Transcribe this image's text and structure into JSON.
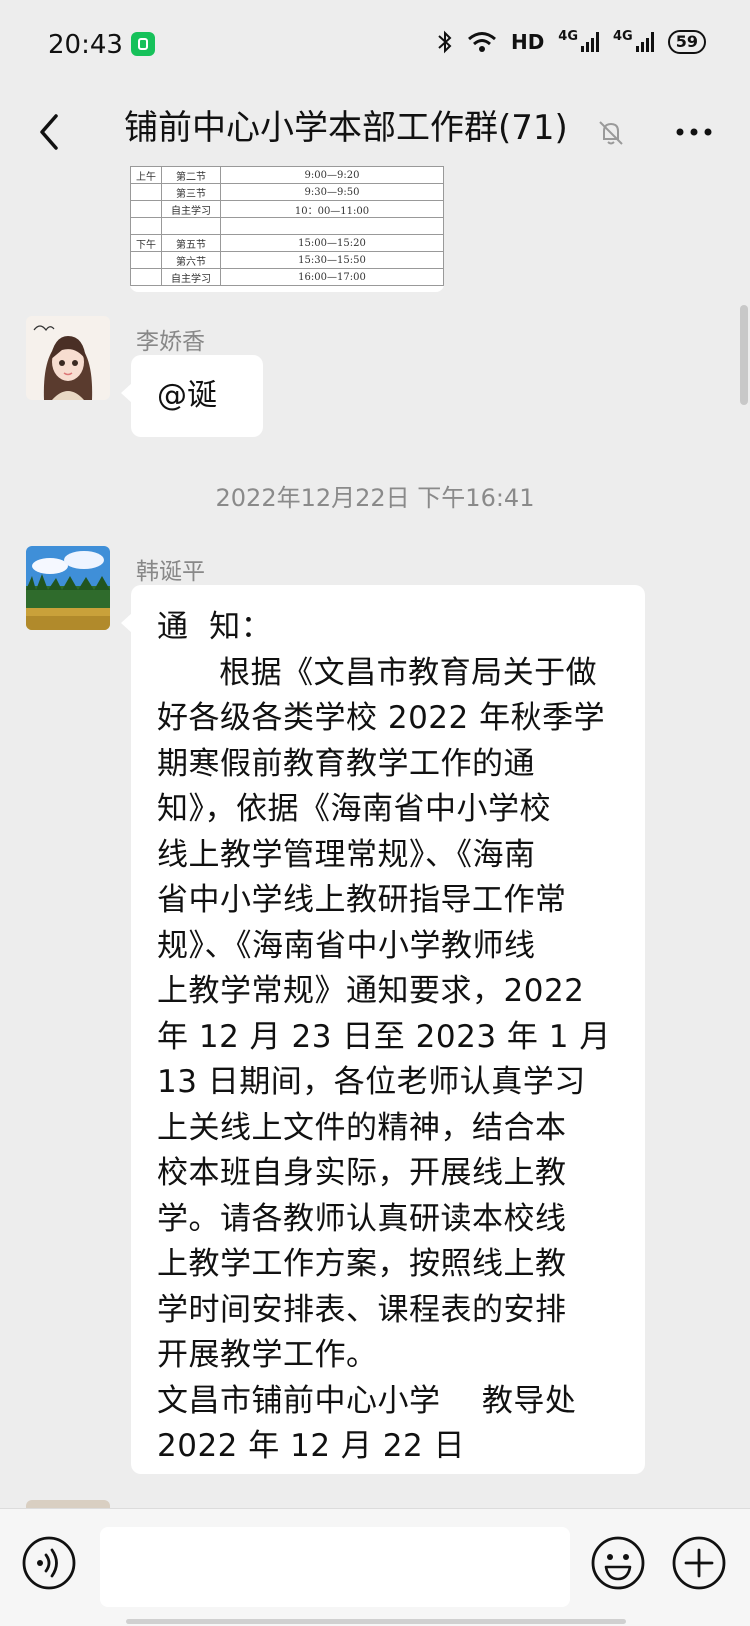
{
  "status_bar": {
    "time": "20:43",
    "network_label": "HD",
    "signal_1": "4G",
    "signal_2": "4G",
    "battery": "59"
  },
  "header": {
    "title": "铺前中心小学本部工作群(71)"
  },
  "shared_image": {
    "rows": [
      {
        "period": "上午",
        "slot": "第二节",
        "time": "9:00—9:20"
      },
      {
        "period": "",
        "slot": "第三节",
        "time": "9:30—9:50"
      },
      {
        "period": "",
        "slot": "自主学习",
        "time": "10：00—11:00"
      },
      {
        "period": "",
        "slot": "",
        "time": ""
      },
      {
        "period": "下午",
        "slot": "第五节",
        "time": "15:00—15:20"
      },
      {
        "period": "",
        "slot": "第六节",
        "time": "15:30—15:50"
      },
      {
        "period": "",
        "slot": "自主学习",
        "time": "16:00—17:00"
      }
    ]
  },
  "messages": [
    {
      "sender": "李娇香",
      "text": "@诞"
    },
    {
      "sender": "韩诞平",
      "lines": [
        "通  知：",
        "      根据《文昌市教育局关于做",
        "好各级各类学校 2022 年秋季学",
        "期寒假前教育教学工作的通",
        "知》，依据《海南省中小学校",
        "线上教学管理常规》、《海南",
        "省中小学线上教研指导工作常",
        "规》、《海南省中小学教师线",
        "上教学常规》通知要求，2022",
        "年 12 月 23 日至 2023 年 1 月",
        "13 日期间，各位老师认真学习",
        "上关线上文件的精神，结合本",
        "校本班自身实际，开展线上教",
        "学。请各教师认真研读本校线",
        "上教学工作方案，按照线上教",
        "学时间安排表、课程表的安排",
        "开展教学工作。",
        "文昌市铺前中心小学    教导处",
        "2022 年 12 月 22 日"
      ]
    }
  ],
  "timestamp": "2022年12月22日 下午16:41",
  "icons": {
    "back": "back-chevron-icon",
    "mute": "bell-muted-icon",
    "more": "more-dots-icon",
    "voice": "voice-icon",
    "emoji": "emoji-icon",
    "plus": "plus-icon"
  }
}
